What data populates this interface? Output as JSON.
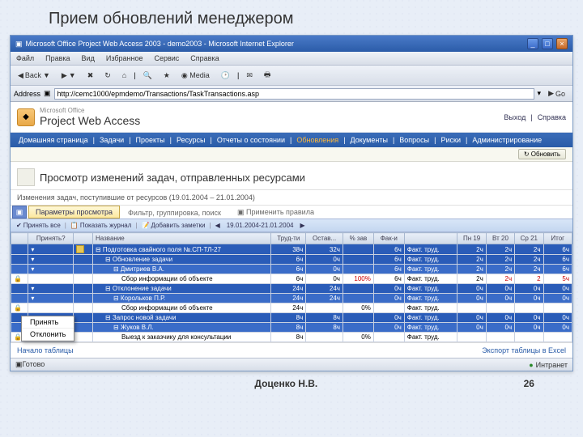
{
  "slide": {
    "title": "Прием обновлений менеджером",
    "author": "Доценко Н.В.",
    "page": "26"
  },
  "win": {
    "title": "Microsoft Office Project Web Access 2003 - demo2003 - Microsoft Internet Explorer",
    "menu": [
      "Файл",
      "Правка",
      "Вид",
      "Избранное",
      "Сервис",
      "Справка"
    ],
    "back": "Back",
    "sep": "▼",
    "address_label": "Address",
    "address": "http://cemc1000/epmdemo/Transactions/TaskTransactions.asp",
    "go": "Go"
  },
  "pwa": {
    "ms": "Microsoft Office",
    "product": "Project Web Access",
    "logout": "Выход",
    "help": "Справка",
    "nav": [
      "Домашняя страница",
      "Задачи",
      "Проекты",
      "Ресурсы",
      "Отчеты о состоянии",
      "Обновления",
      "Документы",
      "Вопросы",
      "Риски",
      "Администрирование"
    ],
    "nav_active": 5,
    "refresh_btn": "Обновить"
  },
  "page": {
    "title": "Просмотр изменений задач, отправленных ресурсами",
    "subtitle": "Изменения задач, поступившие от ресурсов (19.01.2004 – 21.01.2004)",
    "tab": "Параметры просмотра",
    "filt": "Фильтр, группировка, поиск",
    "rules": "Применить правила"
  },
  "actions": {
    "accept": "Принять все",
    "show": "Показать журнал",
    "add": "Добавить заметки",
    "daterange": "19.01.2004-21.01.2004"
  },
  "cols": {
    "accept": "Принять?",
    "name": "Название",
    "work": "Труд-ти",
    "rem": "Остав...",
    "pct": "% зав",
    "act": "Фак-и",
    "d1": "Пн 19",
    "d2": "Вт 20",
    "d3": "Ср 21",
    "d4": "Итог"
  },
  "rows": [
    {
      "sel": true,
      "ind": 0,
      "icon": true,
      "name": "Подготовка свайного поля №.СП-ТЛ-27",
      "work": "38ч",
      "rem": "32ч",
      "pct": "",
      "act": "6ч",
      "ft": "Факт. труд.",
      "d1": "2ч",
      "d2": "2ч",
      "d3": "2ч",
      "d4": "6ч"
    },
    {
      "sel": true,
      "ind": 1,
      "icon": false,
      "name": "Обновление задачи",
      "work": "6ч",
      "rem": "0ч",
      "pct": "",
      "act": "6ч",
      "ft": "Факт. труд.",
      "d1": "2ч",
      "d2": "2ч",
      "d3": "2ч",
      "d4": "6ч"
    },
    {
      "sel": true,
      "ind": 2,
      "icon": false,
      "name": "Дмитриев В.А.",
      "work": "6ч",
      "rem": "0ч",
      "pct": "",
      "act": "6ч",
      "ft": "Факт. труд.",
      "d1": "2ч",
      "d2": "2ч",
      "d3": "2ч",
      "d4": "6ч"
    },
    {
      "sel": false,
      "ind": 3,
      "icon": false,
      "name": "Сбор информации об объекте",
      "work": "6ч",
      "rem": "0ч",
      "pct": "100%",
      "act": "6ч",
      "ft": "Факт. труд.",
      "d1": "2ч",
      "d2": "2ч",
      "d3": "2",
      "d4": "5ч",
      "red": true
    },
    {
      "sel": true,
      "ind": 1,
      "icon": false,
      "name": "Отклонение задачи",
      "work": "24ч",
      "rem": "24ч",
      "pct": "",
      "act": "0ч",
      "ft": "Факт. труд.",
      "d1": "0ч",
      "d2": "0ч",
      "d3": "0ч",
      "d4": "0ч"
    },
    {
      "sel": true,
      "ind": 2,
      "icon": false,
      "name": "Корольков П.Р.",
      "work": "24ч",
      "rem": "24ч",
      "pct": "",
      "act": "0ч",
      "ft": "Факт. труд.",
      "d1": "0ч",
      "d2": "0ч",
      "d3": "0ч",
      "d4": "0ч"
    },
    {
      "sel": false,
      "ind": 3,
      "icon": false,
      "name": "Сбор информации об объекте",
      "work": "24ч",
      "rem": "",
      "pct": "0%",
      "act": "",
      "ft": "Факт. труд.",
      "d1": "",
      "d2": "",
      "d3": "",
      "d4": ""
    },
    {
      "sel": true,
      "ind": 1,
      "icon": false,
      "name": "Запрос новой задачи",
      "work": "8ч",
      "rem": "8ч",
      "pct": "",
      "act": "0ч",
      "ft": "Факт. труд.",
      "d1": "0ч",
      "d2": "0ч",
      "d3": "0ч",
      "d4": "0ч"
    },
    {
      "sel": true,
      "ind": 2,
      "icon": false,
      "name": "Жуков В.Л.",
      "work": "8ч",
      "rem": "8ч",
      "pct": "",
      "act": "0ч",
      "ft": "Факт. труд.",
      "d1": "0ч",
      "d2": "0ч",
      "d3": "0ч",
      "d4": "0ч"
    },
    {
      "sel": false,
      "ind": 3,
      "icon": false,
      "name": "Выезд к заказчику для консультации",
      "work": "8ч",
      "rem": "",
      "pct": "0%",
      "act": "",
      "ft": "Факт. труд.",
      "d1": "",
      "d2": "",
      "d3": "",
      "d4": ""
    }
  ],
  "footer": {
    "left": "Начало таблицы",
    "right": "Экспорт таблицы в Excel"
  },
  "popup": {
    "a": "Принять",
    "b": "Отклонить"
  },
  "status": {
    "done": "Готово",
    "zone": "Интранет"
  }
}
